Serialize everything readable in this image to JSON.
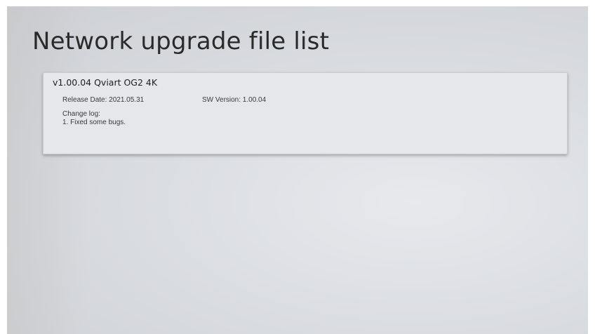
{
  "page": {
    "title": "Network upgrade file list"
  },
  "file_list": [
    {
      "name": "v1.00.04 Qviart OG2 4K",
      "release_date": "Release Date: 2021.05.31",
      "sw_version": "SW Version: 1.00.04",
      "changelog_label": "Change log:",
      "changelog_items": [
        "1. Fixed some bugs."
      ]
    }
  ],
  "colors": {
    "background": "#dadde2",
    "card_background": "#e6e7eb",
    "text": "#2a2a2a"
  }
}
